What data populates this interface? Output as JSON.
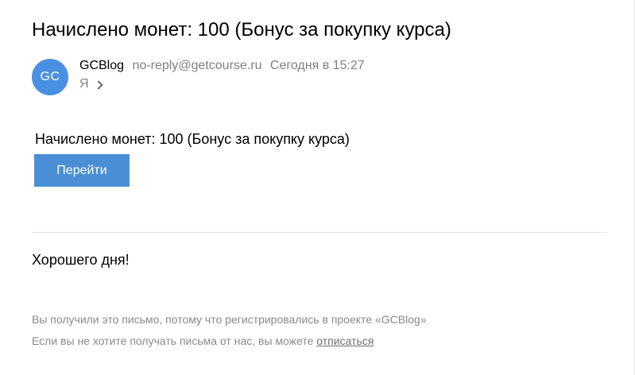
{
  "email": {
    "subject": "Начислено монет: 100 (Бонус за покупку курса)",
    "sender": {
      "avatar_initials": "GC",
      "name": "GCBlog",
      "email": "no-reply@getcourse.ru",
      "date": "Сегодня в 15:27"
    },
    "recipient": "Я",
    "body": {
      "message": "Начислено монет: 100 (Бонус за покупку курса)",
      "button_label": "Перейти",
      "closing": "Хорошего дня!"
    },
    "footer": {
      "line1": "Вы получили это письмо, потому что регистрировались в проекте «GCBlog»",
      "line2_prefix": "Если вы не хотите получать письма от нас, вы можете ",
      "unsubscribe_label": "отписаться"
    }
  },
  "colors": {
    "avatar_bg": "#4a90e2",
    "button_bg": "#4a8fd6",
    "muted_text": "#808080"
  }
}
